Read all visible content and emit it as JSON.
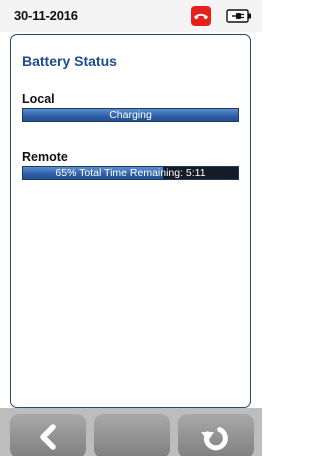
{
  "status_bar": {
    "date": "30-11-2016",
    "icons": [
      "phone-hangup-icon",
      "battery-plug-icon"
    ],
    "phone_badge_color": "#e8201c"
  },
  "panel": {
    "title": "Battery Status",
    "title_color": "#1f4c8e",
    "local": {
      "label": "Local",
      "bar_text": "Charging",
      "level_percent": 100
    },
    "remote": {
      "label": "Remote",
      "bar_text": "65% Total Time Remaining: 5:11",
      "level_percent": 65
    }
  },
  "nav": {
    "buttons": [
      {
        "icon": "back-arrow-icon"
      },
      {
        "icon": ""
      },
      {
        "icon": "refresh-icon"
      }
    ]
  }
}
